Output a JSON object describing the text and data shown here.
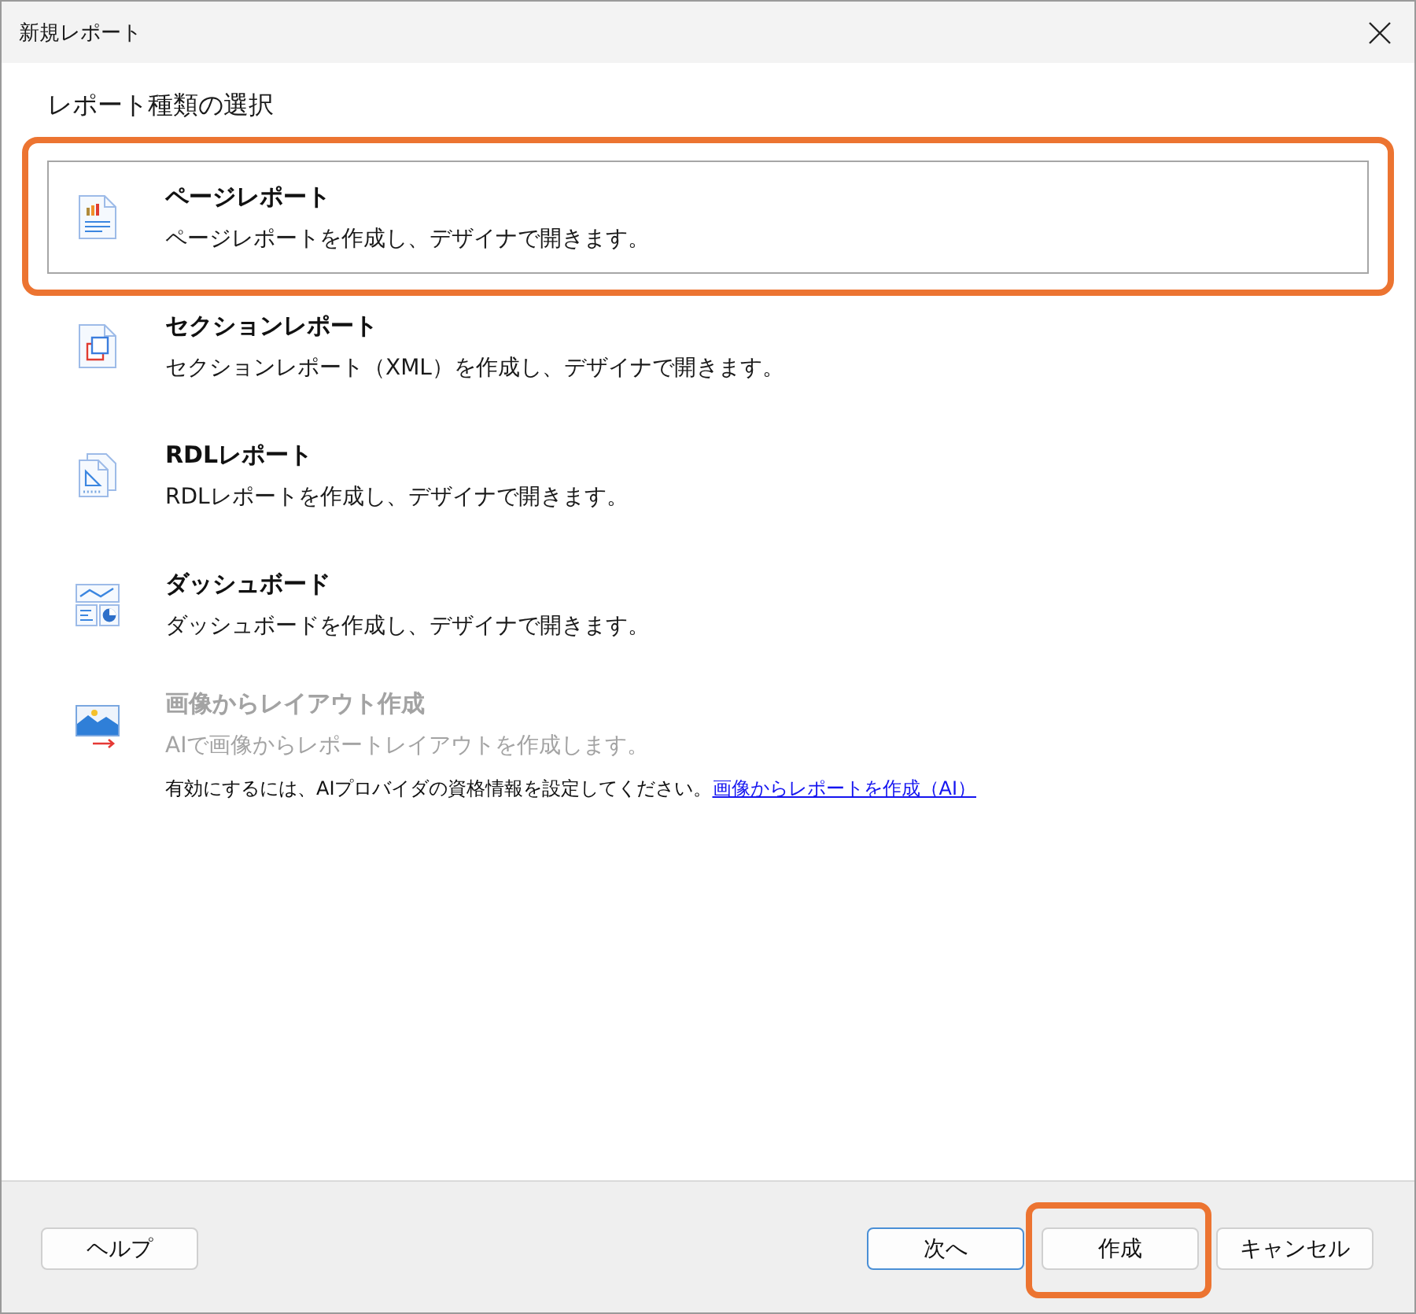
{
  "window": {
    "title": "新規レポート"
  },
  "heading": "レポート種類の選択",
  "report_types": [
    {
      "kind": "page",
      "title": "ページレポート",
      "description": "ページレポートを作成し、デザイナで開きます。",
      "selected": true,
      "disabled": false,
      "highlighted": true
    },
    {
      "kind": "section",
      "title": "セクションレポート",
      "description": "セクションレポート（XML）を作成し、デザイナで開きます。",
      "selected": false,
      "disabled": false,
      "highlighted": false
    },
    {
      "kind": "rdl",
      "title": "RDLレポート",
      "description": "RDLレポートを作成し、デザイナで開きます。",
      "selected": false,
      "disabled": false,
      "highlighted": false
    },
    {
      "kind": "dashboard",
      "title": "ダッシュボード",
      "description": "ダッシュボードを作成し、デザイナで開きます。",
      "selected": false,
      "disabled": false,
      "highlighted": false
    },
    {
      "kind": "image",
      "title": "画像からレイアウト作成",
      "description": "AIで画像からレポートレイアウトを作成します。",
      "selected": false,
      "disabled": true,
      "highlighted": false,
      "note": {
        "text": "有効にするには、AIプロバイダの資格情報を設定してください。",
        "link": "画像からレポートを作成（AI）"
      }
    }
  ],
  "help_button": {
    "label": "ヘルプ"
  },
  "buttons": [
    {
      "label": "次へ",
      "default": true,
      "highlighted": false
    },
    {
      "label": "作成",
      "default": false,
      "highlighted": true
    },
    {
      "label": "キャンセル",
      "default": false,
      "highlighted": false
    }
  ]
}
